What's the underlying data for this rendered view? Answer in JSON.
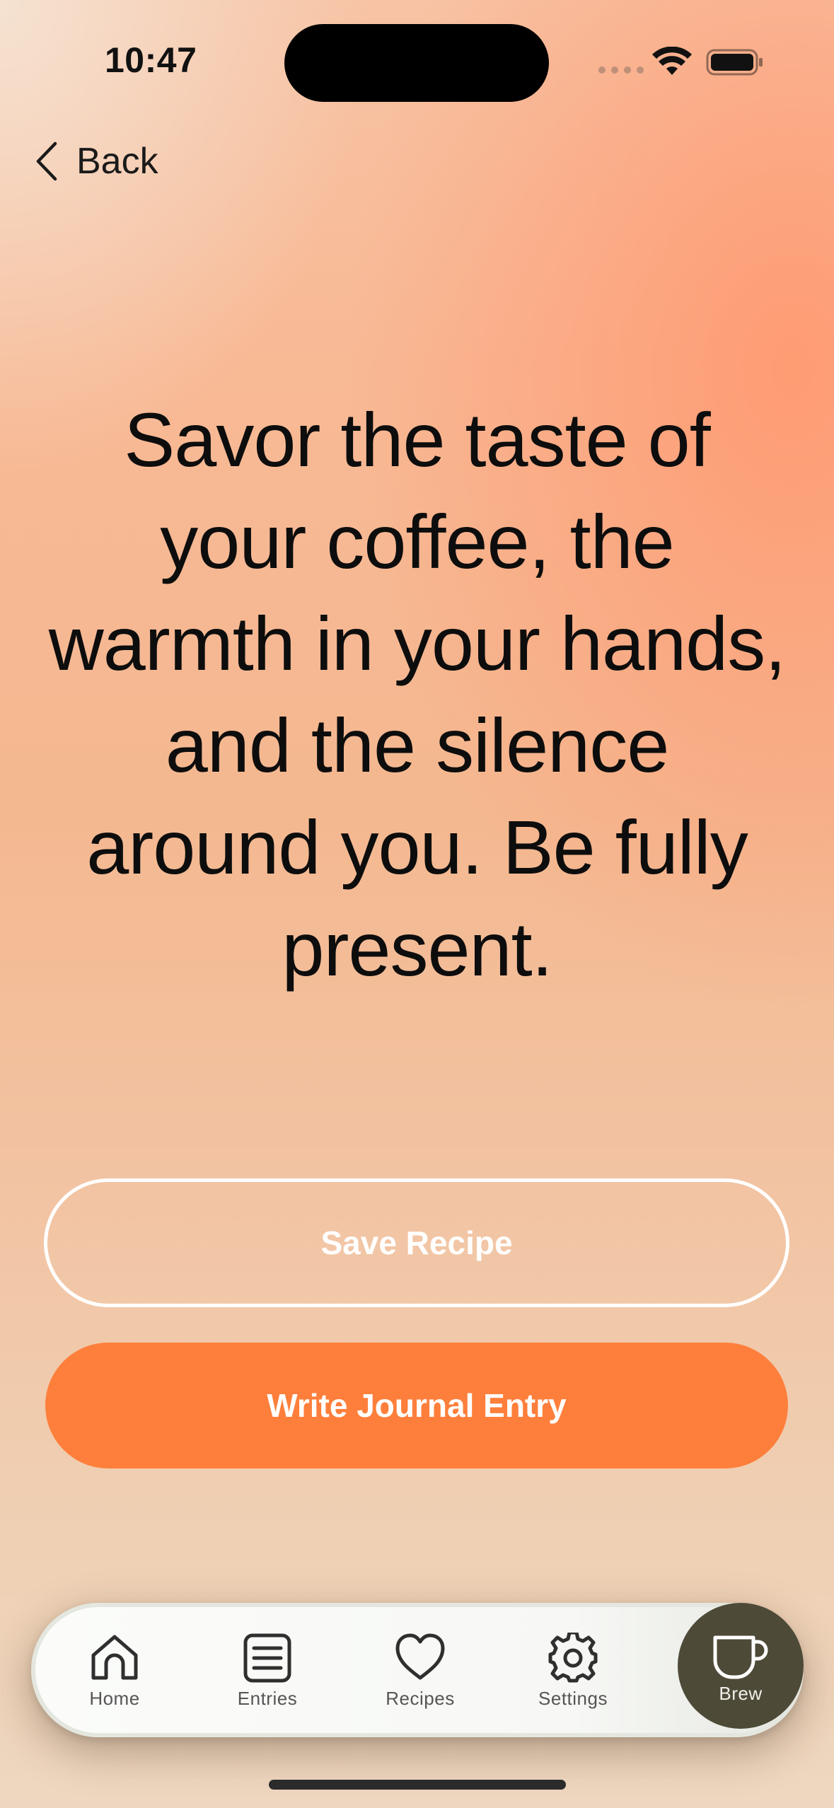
{
  "status_bar": {
    "time": "10:47"
  },
  "nav": {
    "back_label": "Back"
  },
  "quote": {
    "text": "Savor the taste of your coffee, the warmth in your hands, and the silence around you. Be fully present."
  },
  "actions": {
    "save_label": "Save Recipe",
    "journal_label": "Write Journal Entry"
  },
  "tab_bar": {
    "tabs": [
      {
        "label": "Home",
        "icon": "house-icon"
      },
      {
        "label": "Entries",
        "icon": "list-icon"
      },
      {
        "label": "Recipes",
        "icon": "heart-icon"
      },
      {
        "label": "Settings",
        "icon": "gear-icon"
      },
      {
        "label": "Brew",
        "icon": "coffee-cup-icon"
      }
    ]
  },
  "colors": {
    "accent": "#fe7f3b",
    "brew_button": "#4e4a38",
    "quote_text": "#0d0d0d"
  }
}
